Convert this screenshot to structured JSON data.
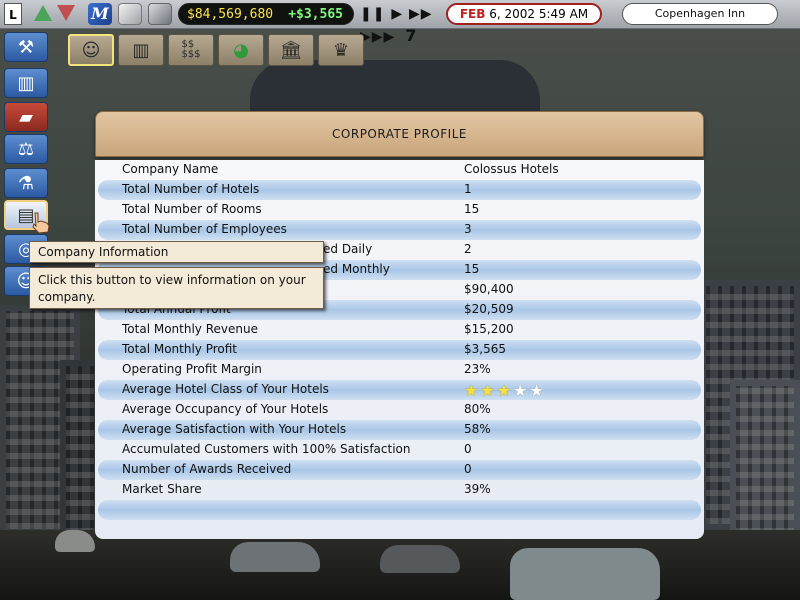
{
  "topbar": {
    "l_button": "L",
    "m_button": "M",
    "money": "$84,569,680",
    "money_delta": "+$3,565",
    "speed_controls": "❚❚ ▶ ▶▶ ▶▶▶",
    "speed_level": "7",
    "date_month": "FEB",
    "date_rest": "6, 2002 5:49 AM",
    "hotel_name": "Copenhagen Inn",
    "icons": [
      "up-arrow-icon",
      "down-arrow-icon",
      "m-icon",
      "box-icon",
      "building-icon"
    ]
  },
  "sidebar": {
    "items": [
      {
        "name": "tools",
        "icon": "hammer-icon"
      },
      {
        "name": "statistics",
        "icon": "bar-chart-icon"
      },
      {
        "name": "book",
        "icon": "book-icon"
      },
      {
        "name": "legal",
        "icon": "scales-icon"
      },
      {
        "name": "research",
        "icon": "microscope-icon"
      },
      {
        "name": "company-info",
        "icon": "document-icon",
        "active": true
      },
      {
        "name": "target",
        "icon": "target-icon"
      },
      {
        "name": "people",
        "icon": "people-icon"
      }
    ]
  },
  "toolbar_row": [
    {
      "name": "staff",
      "icon": "people-icon",
      "active": true
    },
    {
      "name": "finance-chart",
      "icon": "bar-chart-icon"
    },
    {
      "name": "money",
      "icon": "money-icon"
    },
    {
      "name": "pie",
      "icon": "pie-chart-icon"
    },
    {
      "name": "bank",
      "icon": "bank-icon"
    },
    {
      "name": "trophy",
      "icon": "trophy-icon"
    }
  ],
  "panel": {
    "title": "CORPORATE PROFILE",
    "rows": [
      {
        "label": "Company Name",
        "value": "Colossus Hotels"
      },
      {
        "label": "Total Number of Hotels",
        "value": "1"
      },
      {
        "label": "Total Number of Rooms",
        "value": "15"
      },
      {
        "label": "Total Number of Employees",
        "value": "3"
      },
      {
        "label": "ed Daily",
        "value": "2"
      },
      {
        "label": "ed Monthly",
        "value": "15"
      },
      {
        "label": "",
        "value": "$90,400"
      },
      {
        "label": "Total Annual Profit",
        "value": "$20,509"
      },
      {
        "label": "Total Monthly Revenue",
        "value": "$15,200"
      },
      {
        "label": "Total Monthly Profit",
        "value": "$3,565"
      },
      {
        "label": "Operating Profit Margin",
        "value": "23%"
      },
      {
        "label": "Average Hotel Class of Your Hotels",
        "value": "",
        "stars": 3,
        "stars_max": 5
      },
      {
        "label": "Average Occupancy of Your Hotels",
        "value": "80%"
      },
      {
        "label": "Average Satisfaction with Your Hotels",
        "value": "58%"
      },
      {
        "label": "Accumulated Customers with 100% Satisfaction",
        "value": "0"
      },
      {
        "label": "Number of Awards Received",
        "value": "0"
      },
      {
        "label": "Market Share",
        "value": "39%"
      },
      {
        "label": "",
        "value": ""
      }
    ]
  },
  "tooltip": {
    "title": "Company Information",
    "body": "Click this button to view information on your company."
  }
}
